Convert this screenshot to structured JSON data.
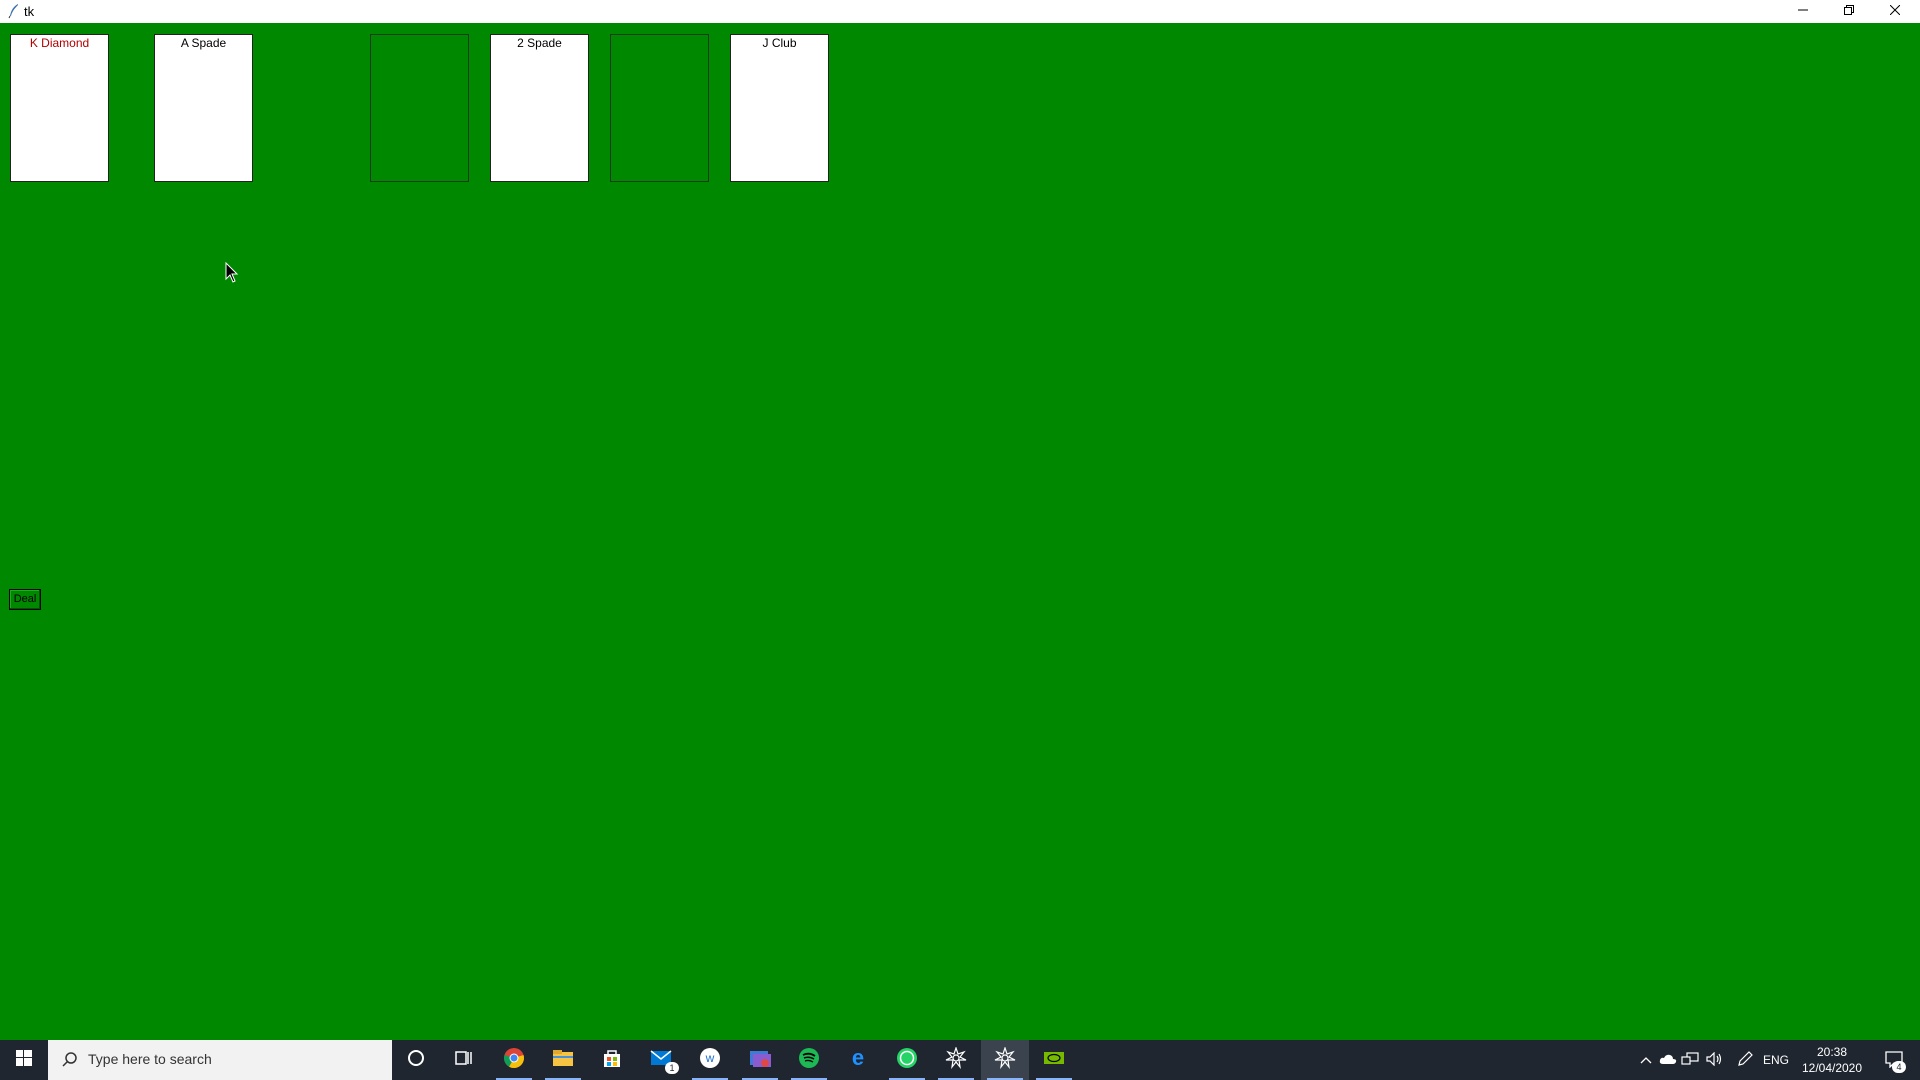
{
  "window": {
    "title": "tk",
    "minimize_icon": "minimize-icon",
    "maximize_icon": "restore-icon",
    "close_icon": "close-icon"
  },
  "table": {
    "background_color": "#008800",
    "cards": [
      {
        "label": "K Diamond",
        "color": "red"
      },
      {
        "label": "A Spade",
        "color": "black"
      },
      {
        "label": "",
        "empty": true
      },
      {
        "label": "2 Spade",
        "color": "black"
      },
      {
        "label": "",
        "empty": true
      },
      {
        "label": "J Club",
        "color": "black"
      }
    ],
    "deal_label": "Deal"
  },
  "taskbar": {
    "search_placeholder": "Type here to search",
    "apps": [
      "cortana-icon",
      "task-view-icon",
      "chrome-icon",
      "file-explorer-icon",
      "store-icon",
      "mail-icon",
      "app-w-icon",
      "photos-icon",
      "spotify-icon",
      "edge-icon",
      "whatsapp-icon",
      "settings-gear-icon",
      "settings-gear-icon-active",
      "nvidia-icon"
    ],
    "mail_badge": "1",
    "language": "ENG",
    "time": "20:38",
    "date": "12/04/2020",
    "notification_count": "4"
  }
}
